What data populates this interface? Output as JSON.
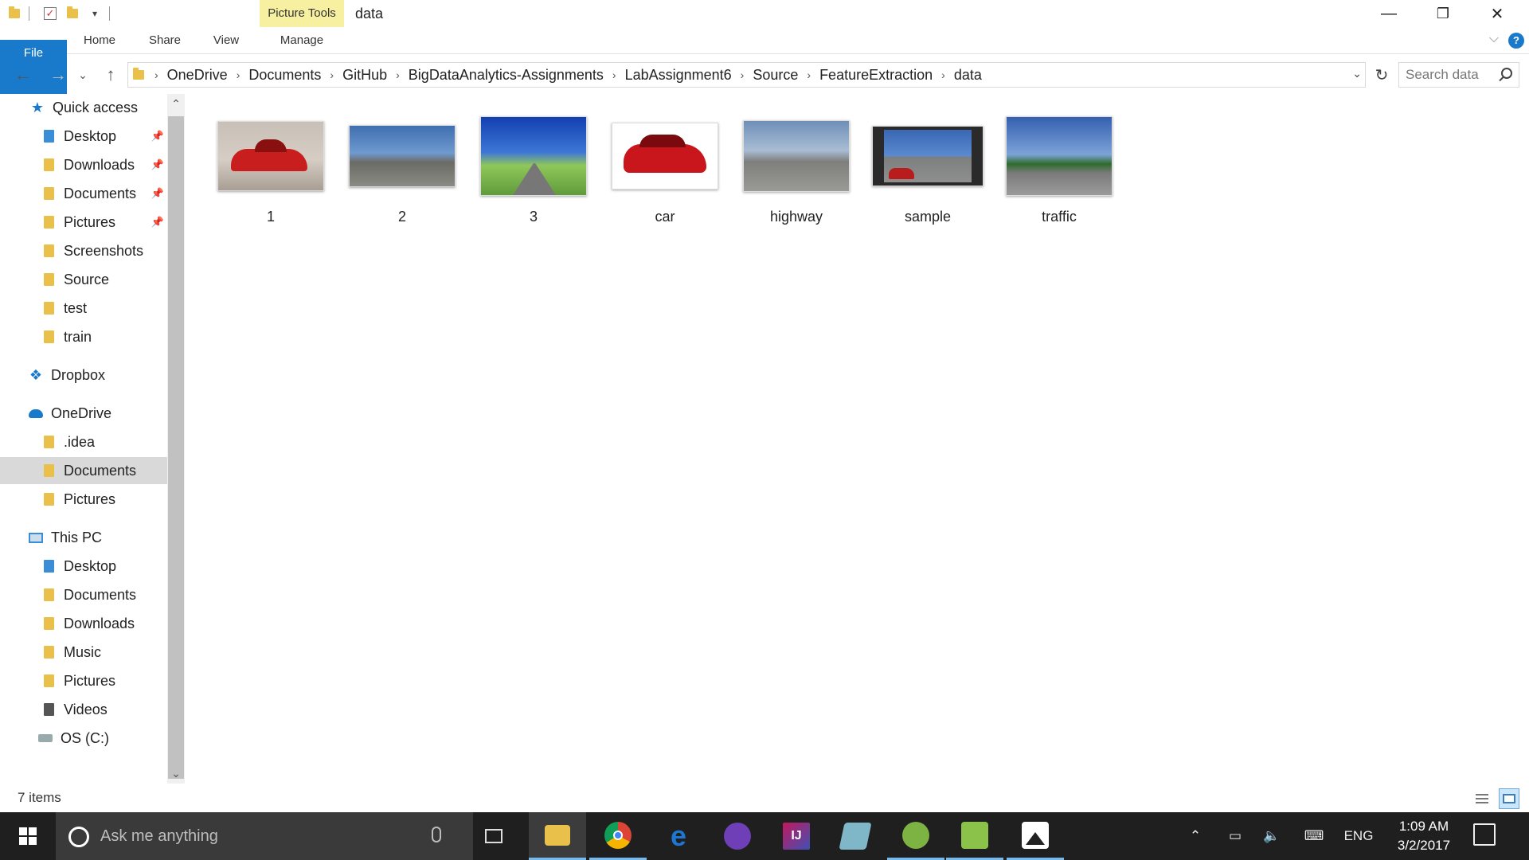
{
  "window": {
    "title": "data",
    "context_tab": "Picture Tools",
    "controls": {
      "minimize": "—",
      "restore": "❐",
      "close": "✕"
    }
  },
  "ribbon": {
    "tabs": [
      "File",
      "Home",
      "Share",
      "View",
      "Manage"
    ],
    "help": "?",
    "collapse": "⌵"
  },
  "nav": {
    "back": "←",
    "forward": "→",
    "recent": "⌄",
    "up": "↑"
  },
  "address": {
    "crumbs": [
      "OneDrive",
      "Documents",
      "GitHub",
      "BigDataAnalytics-Assignments",
      "LabAssignment6",
      "Source",
      "FeatureExtraction",
      "data"
    ],
    "separator": "›",
    "dropdown": "⌄",
    "refresh": "↻"
  },
  "search": {
    "placeholder": "Search data"
  },
  "sidebar": {
    "pin": "📌",
    "quick_access": "Quick access",
    "quick_items": [
      {
        "label": "Desktop",
        "pinned": true
      },
      {
        "label": "Downloads",
        "pinned": true
      },
      {
        "label": "Documents",
        "pinned": true
      },
      {
        "label": "Pictures",
        "pinned": true
      },
      {
        "label": "Screenshots",
        "pinned": false
      },
      {
        "label": "Source",
        "pinned": false
      },
      {
        "label": "test",
        "pinned": false
      },
      {
        "label": "train",
        "pinned": false
      }
    ],
    "dropbox": "Dropbox",
    "onedrive": "OneDrive",
    "onedrive_items": [
      ".idea",
      "Documents",
      "Pictures"
    ],
    "this_pc": "This PC",
    "pc_items": [
      "Desktop",
      "Documents",
      "Downloads",
      "Music",
      "Pictures",
      "Videos",
      "OS (C:)"
    ],
    "selected": "Documents",
    "scroll_up": "⌃",
    "scroll_down": "⌄"
  },
  "files": [
    {
      "name": "1",
      "icon": "image-thumbnail"
    },
    {
      "name": "2",
      "icon": "image-thumbnail"
    },
    {
      "name": "3",
      "icon": "image-thumbnail"
    },
    {
      "name": "car",
      "icon": "image-thumbnail"
    },
    {
      "name": "highway",
      "icon": "image-thumbnail"
    },
    {
      "name": "sample",
      "icon": "video-thumbnail"
    },
    {
      "name": "traffic",
      "icon": "image-thumbnail"
    }
  ],
  "status": {
    "count": "7 items"
  },
  "taskbar": {
    "search_placeholder": "Ask me anything",
    "apps": [
      {
        "name": "file-explorer",
        "label": "",
        "color": "#e8c04a"
      },
      {
        "name": "chrome",
        "label": "",
        "color": "#db4437"
      },
      {
        "name": "edge",
        "label": "e",
        "color": "#1c76d2"
      },
      {
        "name": "github",
        "label": "",
        "color": "#6e3fb6"
      },
      {
        "name": "intellij",
        "label": "IJ",
        "color": "#c2185b"
      },
      {
        "name": "notes",
        "label": "",
        "color": "#7fb7c9"
      },
      {
        "name": "android-studio",
        "label": "",
        "color": "#7cb342"
      },
      {
        "name": "app-green",
        "label": "",
        "color": "#8bc34a"
      },
      {
        "name": "photos",
        "label": "",
        "color": "#ffffff"
      }
    ],
    "tray": {
      "language": "ENG"
    },
    "time": "1:09 AM",
    "date": "3/2/2017"
  }
}
